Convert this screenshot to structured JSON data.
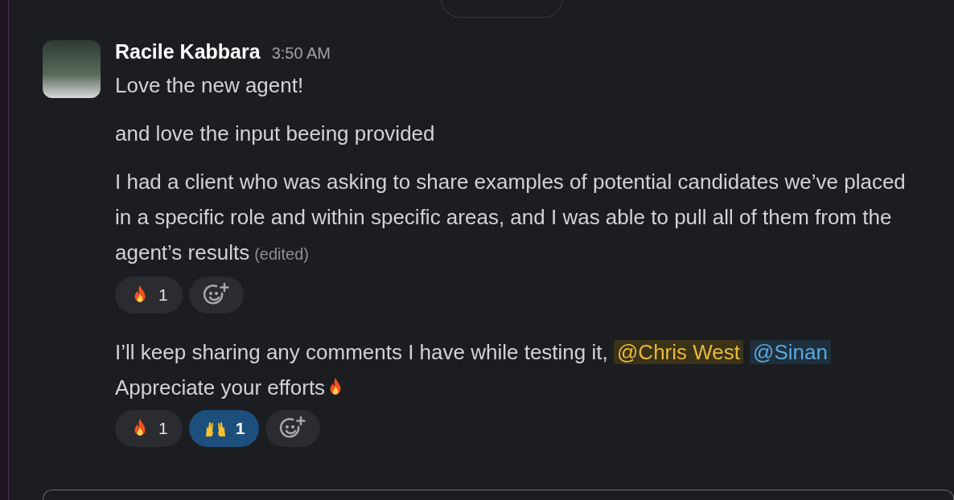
{
  "message": {
    "author": "Racile Kabbara",
    "time": "3:50 AM",
    "blocks": [
      {
        "parts": [
          {
            "kind": "text",
            "text": "Love the new agent!"
          }
        ]
      },
      {
        "parts": [
          {
            "kind": "text",
            "text": "and love the input beeing provided"
          }
        ]
      },
      {
        "parts": [
          {
            "kind": "text",
            "text": "I had a client who was asking to share examples of potential candidates we’ve placed in a specific role and within specific areas, and I was able to pull all of them from the agent’s results"
          }
        ],
        "edited": "(edited)",
        "reactions": [
          {
            "kind": "fire",
            "count": "1",
            "selected": false
          }
        ]
      },
      {
        "parts": [
          {
            "kind": "text",
            "text": "I’ll keep sharing any comments I have while testing it, "
          },
          {
            "kind": "mention",
            "text": "@Chris West",
            "self": true
          },
          {
            "kind": "mention",
            "text": "@Sinan",
            "self": false
          },
          {
            "kind": "break"
          },
          {
            "kind": "text",
            "text": "Appreciate your efforts"
          },
          {
            "kind": "fire_emoji"
          }
        ],
        "reactions": [
          {
            "kind": "fire",
            "count": "1",
            "selected": false
          },
          {
            "kind": "raised_hands",
            "count": "1",
            "selected": true
          }
        ]
      }
    ]
  }
}
